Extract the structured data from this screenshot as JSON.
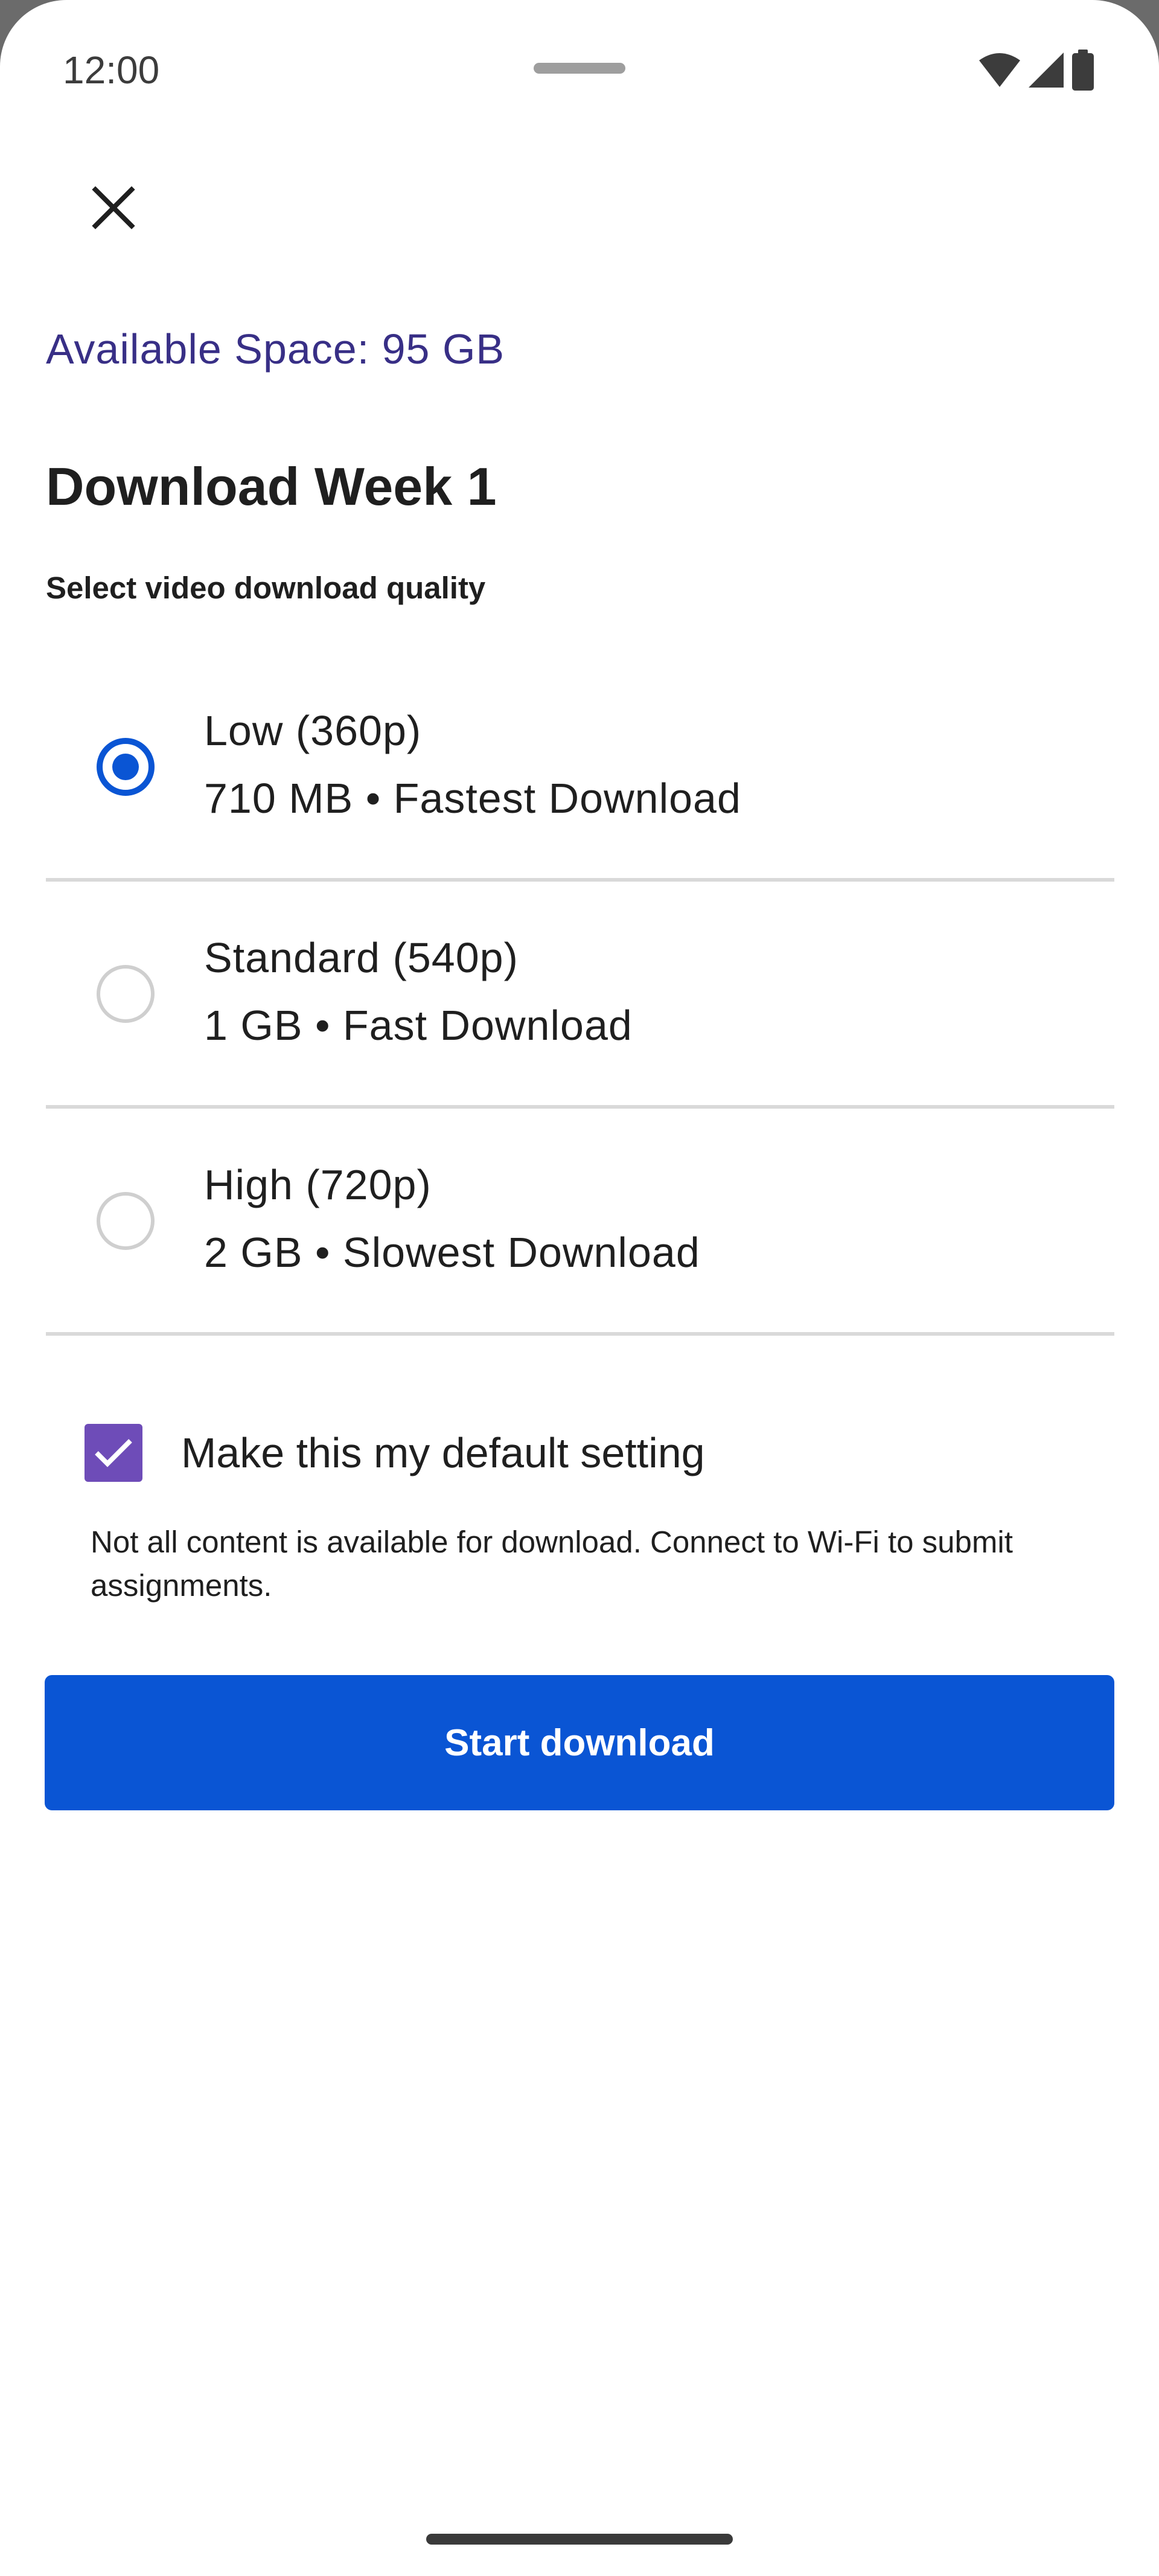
{
  "status_bar": {
    "time": "12:00",
    "icons": [
      "wifi-icon",
      "cell-signal-icon",
      "battery-icon"
    ]
  },
  "dialog": {
    "close_icon": "close-icon",
    "available_space": "Available Space: 95 GB",
    "title": "Download Week 1",
    "subtitle": "Select video download quality",
    "options": [
      {
        "title": "Low (360p)",
        "description": "710 MB • Fastest Download",
        "selected": true
      },
      {
        "title": "Standard (540p)",
        "description": "1 GB • Fast Download",
        "selected": false
      },
      {
        "title": "High (720p)",
        "description": "2 GB • Slowest Download",
        "selected": false
      }
    ],
    "default_setting": {
      "label": "Make this my default setting",
      "checked": true
    },
    "note": "Not all content is available for download. Connect to Wi-Fi to submit assignments.",
    "start_button": "Start download"
  },
  "colors": {
    "accent_blue": "#0a55d4",
    "space_text": "#382f86",
    "checkbox_purple": "#6e4cb8",
    "divider": "#d9d9d9"
  }
}
